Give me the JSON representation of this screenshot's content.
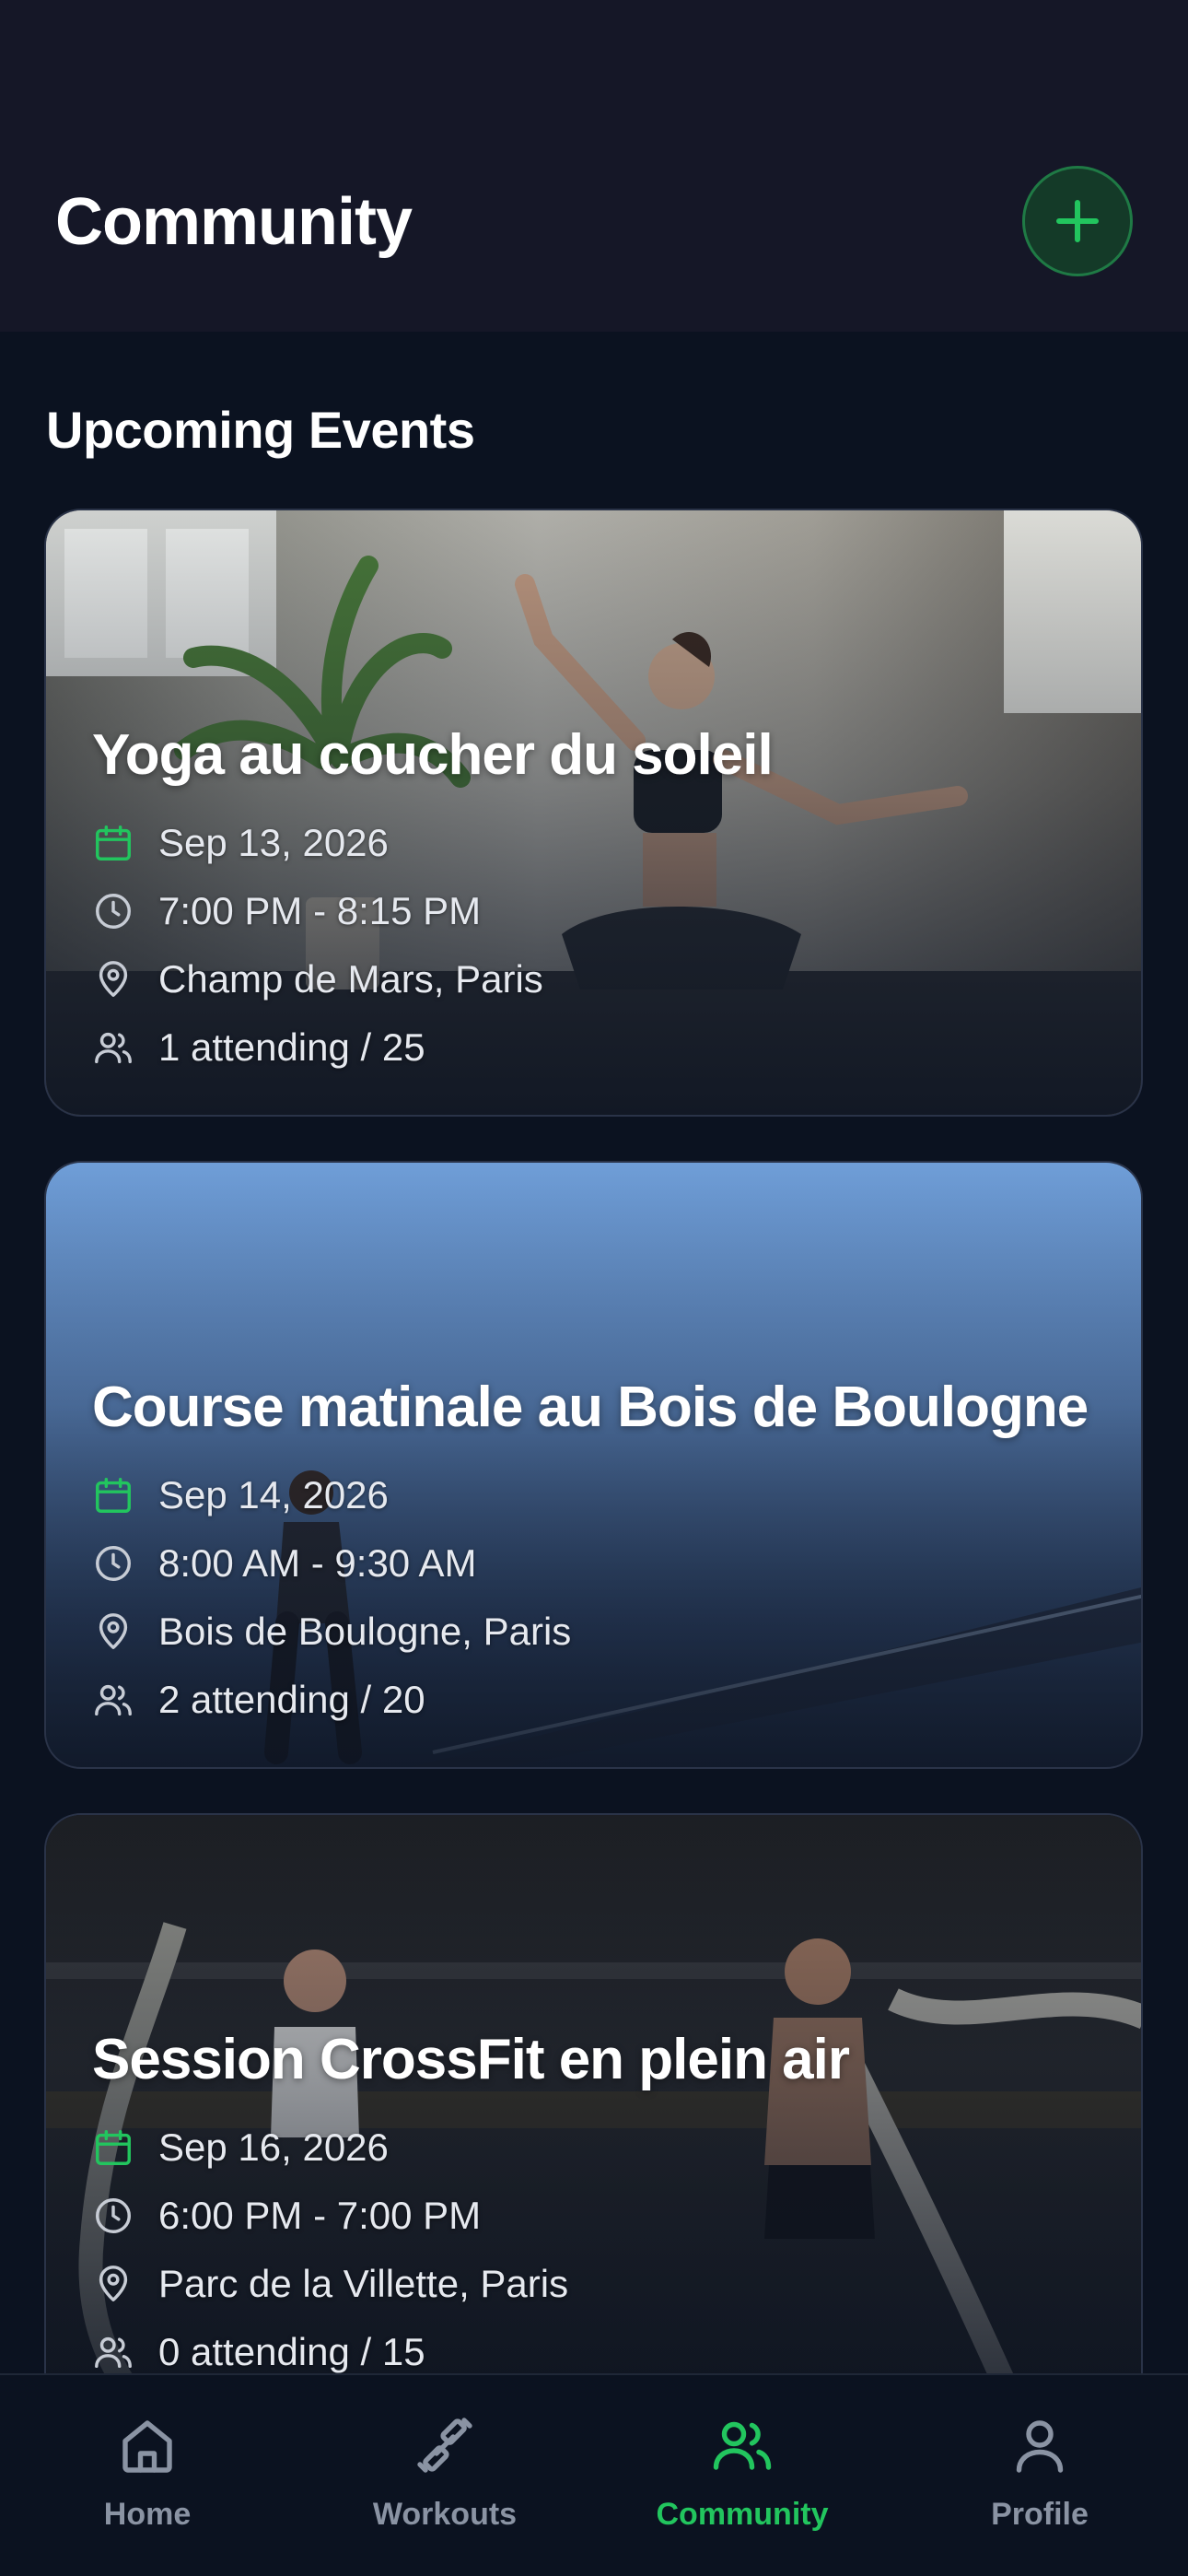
{
  "header": {
    "title": "Community",
    "add_icon": "plus-icon"
  },
  "section": {
    "title": "Upcoming Events"
  },
  "events": [
    {
      "title": "Yoga au coucher du soleil",
      "date": "Sep 13, 2026",
      "time": "7:00 PM - 8:15 PM",
      "location": "Champ de Mars, Paris",
      "attendance": "1 attending / 25",
      "image": "yoga-photo"
    },
    {
      "title": "Course matinale au Bois de Boulogne",
      "date": "Sep 14, 2026",
      "time": "8:00 AM - 9:30 AM",
      "location": "Bois de Boulogne, Paris",
      "attendance": "2 attending / 20",
      "image": "running-photo"
    },
    {
      "title": "Session CrossFit en plein air",
      "date": "Sep 16, 2026",
      "time": "6:00 PM - 7:00 PM",
      "location": "Parc de la Villette, Paris",
      "attendance": "0 attending / 15",
      "image": "crossfit-photo"
    }
  ],
  "tabs": [
    {
      "label": "Home",
      "icon": "home-icon",
      "active": false
    },
    {
      "label": "Workouts",
      "icon": "dumbbell-icon",
      "active": false
    },
    {
      "label": "Community",
      "icon": "users-icon",
      "active": true
    },
    {
      "label": "Profile",
      "icon": "user-icon",
      "active": false
    }
  ],
  "colors": {
    "accent": "#22c55e",
    "background": "#0b1220",
    "header": "#151727",
    "inactive": "#8a93a3"
  }
}
